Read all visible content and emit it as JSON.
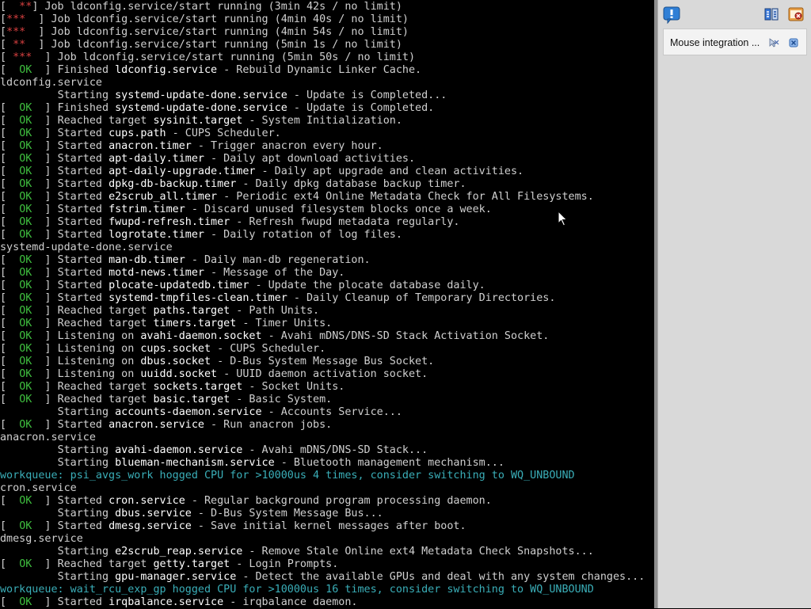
{
  "console": {
    "lines": [
      {
        "kind": "job",
        "status": "  **",
        "text": "Job ldconfig.service/start running (3min 42s / no limit)"
      },
      {
        "kind": "job",
        "status": "***  ",
        "text": "Job ldconfig.service/start running (4min 40s / no limit)"
      },
      {
        "kind": "job",
        "status": "***  ",
        "text": "Job ldconfig.service/start running (4min 54s / no limit)"
      },
      {
        "kind": "job",
        "status": " **  ",
        "text": "Job ldconfig.service/start running (5min 1s / no limit)"
      },
      {
        "kind": "job",
        "status": " ***  ",
        "text": "Job ldconfig.service/start running (5min 50s / no limit)"
      },
      {
        "kind": "ok",
        "verb": "Finished ",
        "unit": "ldconfig.service",
        "desc": " - Rebuild Dynamic Linker Cache."
      },
      {
        "kind": "plain",
        "text": "ldconfig.service"
      },
      {
        "kind": "start",
        "verb": "Starting ",
        "unit": "systemd-update-done.service",
        "desc": " - Update is Completed..."
      },
      {
        "kind": "ok",
        "verb": "Finished ",
        "unit": "systemd-update-done.service",
        "desc": " - Update is Completed."
      },
      {
        "kind": "ok",
        "verb": "Reached target ",
        "unit": "sysinit.target",
        "desc": " - System Initialization."
      },
      {
        "kind": "ok",
        "verb": "Started ",
        "unit": "cups.path",
        "desc": " - CUPS Scheduler."
      },
      {
        "kind": "ok",
        "verb": "Started ",
        "unit": "anacron.timer",
        "desc": " - Trigger anacron every hour."
      },
      {
        "kind": "ok",
        "verb": "Started ",
        "unit": "apt-daily.timer",
        "desc": " - Daily apt download activities."
      },
      {
        "kind": "ok",
        "verb": "Started ",
        "unit": "apt-daily-upgrade.timer",
        "desc": " - Daily apt upgrade and clean activities."
      },
      {
        "kind": "ok",
        "verb": "Started ",
        "unit": "dpkg-db-backup.timer",
        "desc": " - Daily dpkg database backup timer."
      },
      {
        "kind": "ok",
        "verb": "Started ",
        "unit": "e2scrub_all.timer",
        "desc": " - Periodic ext4 Online Metadata Check for All Filesystems."
      },
      {
        "kind": "ok",
        "verb": "Started ",
        "unit": "fstrim.timer",
        "desc": " - Discard unused filesystem blocks once a week."
      },
      {
        "kind": "ok",
        "verb": "Started ",
        "unit": "fwupd-refresh.timer",
        "desc": " - Refresh fwupd metadata regularly."
      },
      {
        "kind": "ok",
        "verb": "Started ",
        "unit": "logrotate.timer",
        "desc": " - Daily rotation of log files."
      },
      {
        "kind": "plain",
        "text": "systemd-update-done.service"
      },
      {
        "kind": "ok",
        "verb": "Started ",
        "unit": "man-db.timer",
        "desc": " - Daily man-db regeneration."
      },
      {
        "kind": "ok",
        "verb": "Started ",
        "unit": "motd-news.timer",
        "desc": " - Message of the Day."
      },
      {
        "kind": "ok",
        "verb": "Started ",
        "unit": "plocate-updatedb.timer",
        "desc": " - Update the plocate database daily."
      },
      {
        "kind": "ok",
        "verb": "Started ",
        "unit": "systemd-tmpfiles-clean.timer",
        "desc": " - Daily Cleanup of Temporary Directories."
      },
      {
        "kind": "ok",
        "verb": "Reached target ",
        "unit": "paths.target",
        "desc": " - Path Units."
      },
      {
        "kind": "ok",
        "verb": "Reached target ",
        "unit": "timers.target",
        "desc": " - Timer Units."
      },
      {
        "kind": "ok",
        "verb": "Listening on ",
        "unit": "avahi-daemon.socket",
        "desc": " - Avahi mDNS/DNS-SD Stack Activation Socket."
      },
      {
        "kind": "ok",
        "verb": "Listening on ",
        "unit": "cups.socket",
        "desc": " - CUPS Scheduler."
      },
      {
        "kind": "ok",
        "verb": "Listening on ",
        "unit": "dbus.socket",
        "desc": " - D-Bus System Message Bus Socket."
      },
      {
        "kind": "ok",
        "verb": "Listening on ",
        "unit": "uuidd.socket",
        "desc": " - UUID daemon activation socket."
      },
      {
        "kind": "ok",
        "verb": "Reached target ",
        "unit": "sockets.target",
        "desc": " - Socket Units."
      },
      {
        "kind": "ok",
        "verb": "Reached target ",
        "unit": "basic.target",
        "desc": " - Basic System."
      },
      {
        "kind": "start",
        "verb": "Starting ",
        "unit": "accounts-daemon.service",
        "desc": " - Accounts Service..."
      },
      {
        "kind": "ok",
        "verb": "Started ",
        "unit": "anacron.service",
        "desc": " - Run anacron jobs."
      },
      {
        "kind": "plain",
        "text": "anacron.service"
      },
      {
        "kind": "start",
        "verb": "Starting ",
        "unit": "avahi-daemon.service",
        "desc": " - Avahi mDNS/DNS-SD Stack..."
      },
      {
        "kind": "start",
        "verb": "Starting ",
        "unit": "blueman-mechanism.service",
        "desc": " - Bluetooth management mechanism..."
      },
      {
        "kind": "cyan",
        "text": "workqueue: psi_avgs_work hogged CPU for >10000us 4 times, consider switching to WQ_UNBOUND"
      },
      {
        "kind": "plain",
        "text": "cron.service"
      },
      {
        "kind": "ok",
        "verb": "Started ",
        "unit": "cron.service",
        "desc": " - Regular background program processing daemon."
      },
      {
        "kind": "start",
        "verb": "Starting ",
        "unit": "dbus.service",
        "desc": " - D-Bus System Message Bus..."
      },
      {
        "kind": "ok",
        "verb": "Started ",
        "unit": "dmesg.service",
        "desc": " - Save initial kernel messages after boot."
      },
      {
        "kind": "plain",
        "text": "dmesg.service"
      },
      {
        "kind": "start",
        "verb": "Starting ",
        "unit": "e2scrub_reap.service",
        "desc": " - Remove Stale Online ext4 Metadata Check Snapshots..."
      },
      {
        "kind": "ok",
        "verb": "Reached target ",
        "unit": "getty.target",
        "desc": " - Login Prompts."
      },
      {
        "kind": "start",
        "verb": "Starting ",
        "unit": "gpu-manager.service",
        "desc": " - Detect the available GPUs and deal with any system changes..."
      },
      {
        "kind": "cyan",
        "text": "workqueue: wait_rcu_exp_gp hogged CPU for >10000us 16 times, consider switching to WQ_UNBOUND"
      },
      {
        "kind": "ok",
        "verb": "Started ",
        "unit": "irqbalance.service",
        "desc": " - irqbalance daemon."
      }
    ]
  },
  "sidebar": {
    "notification_text": "Mouse integration ...",
    "icons": {
      "help": "help-balloon-icon",
      "seamless": "seamless-mode-icon",
      "close_vm": "close-vm-icon",
      "notice_dismiss": "mouse-pointer-icon",
      "notice_close": "close-icon"
    }
  },
  "colors": {
    "ok": "#3fbf3f",
    "fail": "#d84040",
    "cyan": "#3aaeb8",
    "text": "#d0d0d0"
  }
}
